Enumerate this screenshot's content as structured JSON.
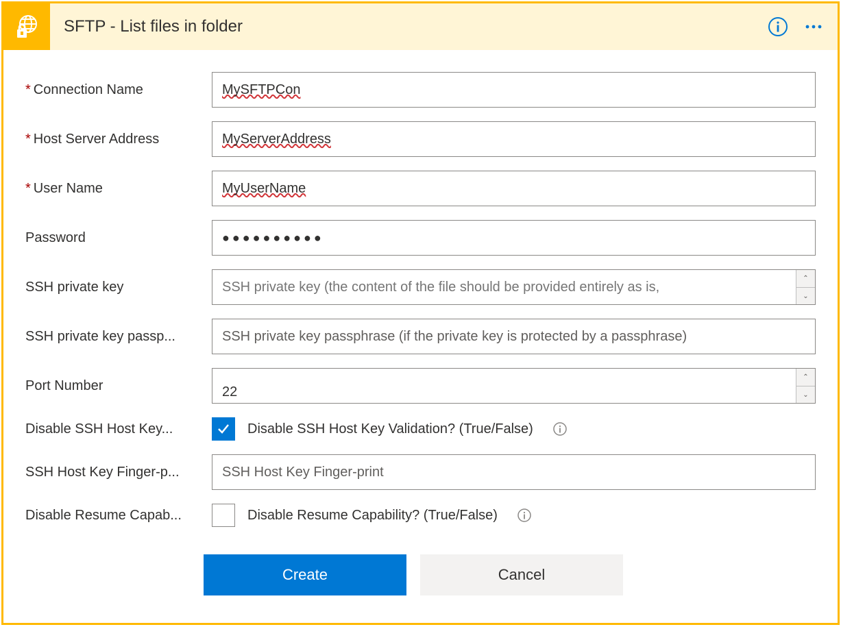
{
  "header": {
    "title": "SFTP - List files in folder"
  },
  "fields": {
    "connection_name": {
      "label": "Connection Name",
      "required": true,
      "value": "MySFTPCon"
    },
    "host": {
      "label": "Host Server Address",
      "required": true,
      "value": "MyServerAddress"
    },
    "user": {
      "label": "User Name",
      "required": true,
      "value": "MyUserName"
    },
    "password": {
      "label": "Password",
      "value": "●●●●●●●●●●"
    },
    "ssh_key": {
      "label": "SSH private key",
      "placeholder": "SSH private key (the content of the file should be provided entirely as is,"
    },
    "ssh_pass": {
      "label": "SSH private key passp...",
      "placeholder": "SSH private key passphrase (if the private key is protected by a passphrase)"
    },
    "port": {
      "label": "Port Number",
      "value": "22"
    },
    "disable_key": {
      "label": "Disable SSH Host Key...",
      "text": "Disable SSH Host Key Validation? (True/False)",
      "checked": true
    },
    "fingerprint": {
      "label": "SSH Host Key Finger-p...",
      "placeholder": "SSH Host Key Finger-print"
    },
    "disable_resume": {
      "label": "Disable Resume Capab...",
      "text": "Disable Resume Capability? (True/False)",
      "checked": false
    }
  },
  "buttons": {
    "create": "Create",
    "cancel": "Cancel"
  }
}
